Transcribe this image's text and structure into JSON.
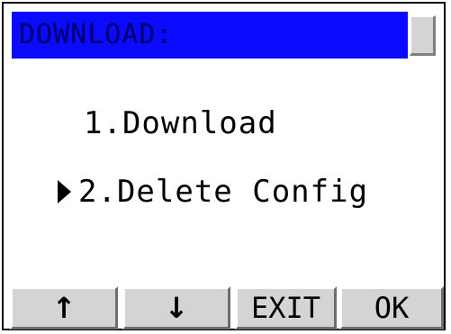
{
  "title": {
    "text": "DOWNLOAD:"
  },
  "menu": {
    "items": [
      {
        "label": "1.Download",
        "selected": false
      },
      {
        "label": "2.Delete Config",
        "selected": true
      }
    ]
  },
  "softkeys": {
    "up": {
      "icon": "arrow-up-icon",
      "glyph": "🡅"
    },
    "down": {
      "icon": "arrow-down-icon",
      "glyph": "🡇"
    },
    "exit": {
      "label": "EXIT"
    },
    "ok": {
      "label": "OK"
    }
  },
  "colors": {
    "titlebar": "#0a0aff",
    "title_text": "#000068",
    "key_face": "#d4d4d4"
  }
}
